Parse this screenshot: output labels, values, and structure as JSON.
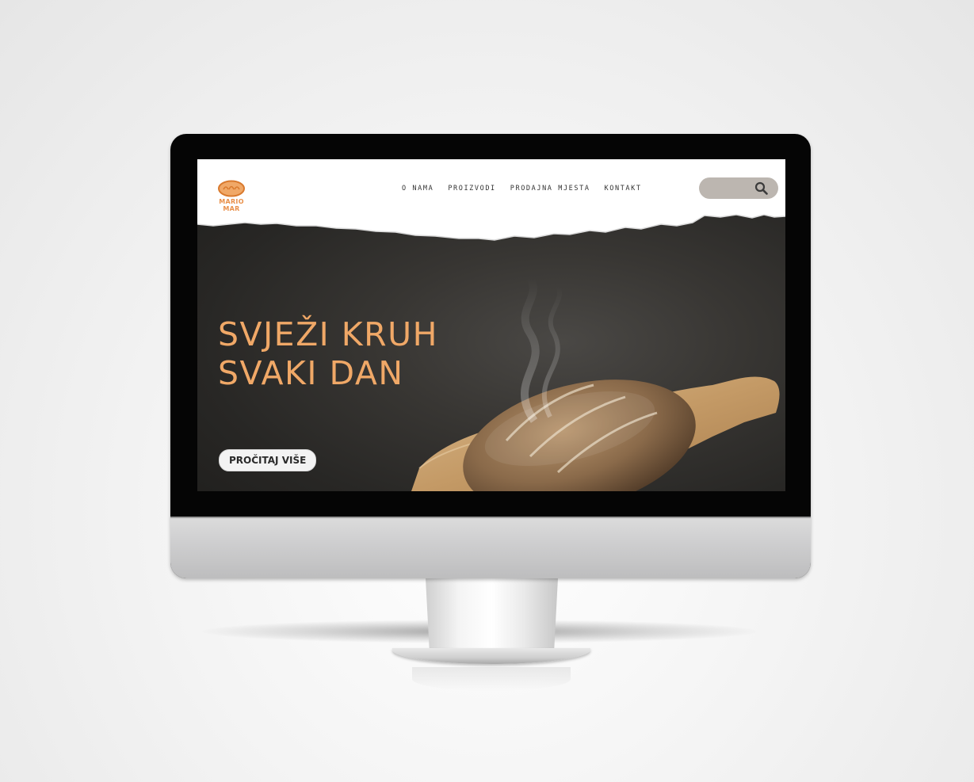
{
  "brand": {
    "name": "MARIO MAR",
    "accent": "#e9904a"
  },
  "nav": {
    "items": [
      {
        "label": "O NAMA"
      },
      {
        "label": "PROIZVODI"
      },
      {
        "label": "PRODAJNA MJESTA"
      },
      {
        "label": "KONTAKT"
      }
    ]
  },
  "search": {
    "placeholder": "",
    "icon": "search-icon"
  },
  "hero": {
    "headline_line1": "SVJEŽI KRUH",
    "headline_line2": "SVAKI DAN",
    "headline_color": "#f0a867",
    "cta_label": "PROČITAJ VIŠE"
  }
}
